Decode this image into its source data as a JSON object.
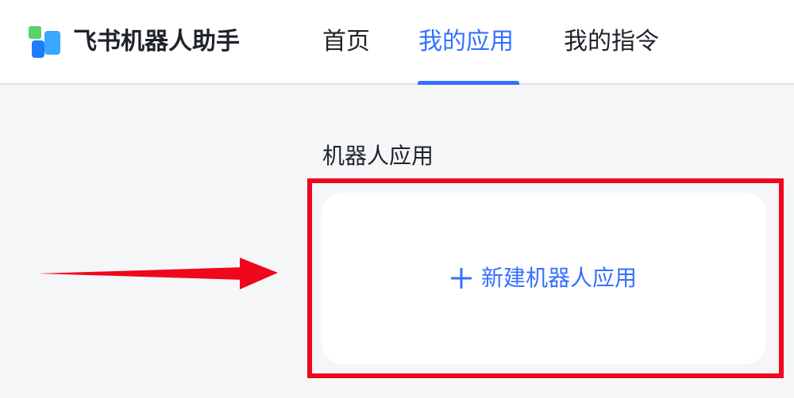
{
  "header": {
    "app_title": "飞书机器人助手",
    "logo_icon": "feishu-logo-icon",
    "tabs": [
      {
        "label": "首页",
        "active": false
      },
      {
        "label": "我的应用",
        "active": true
      },
      {
        "label": "我的指令",
        "active": false
      }
    ]
  },
  "main": {
    "section_title": "机器人应用",
    "create_button_label": "新建机器人应用",
    "create_button_icon": "plus-icon"
  },
  "colors": {
    "accent": "#3370ff",
    "highlight": "#f0061d",
    "background": "#f5f6f7"
  }
}
